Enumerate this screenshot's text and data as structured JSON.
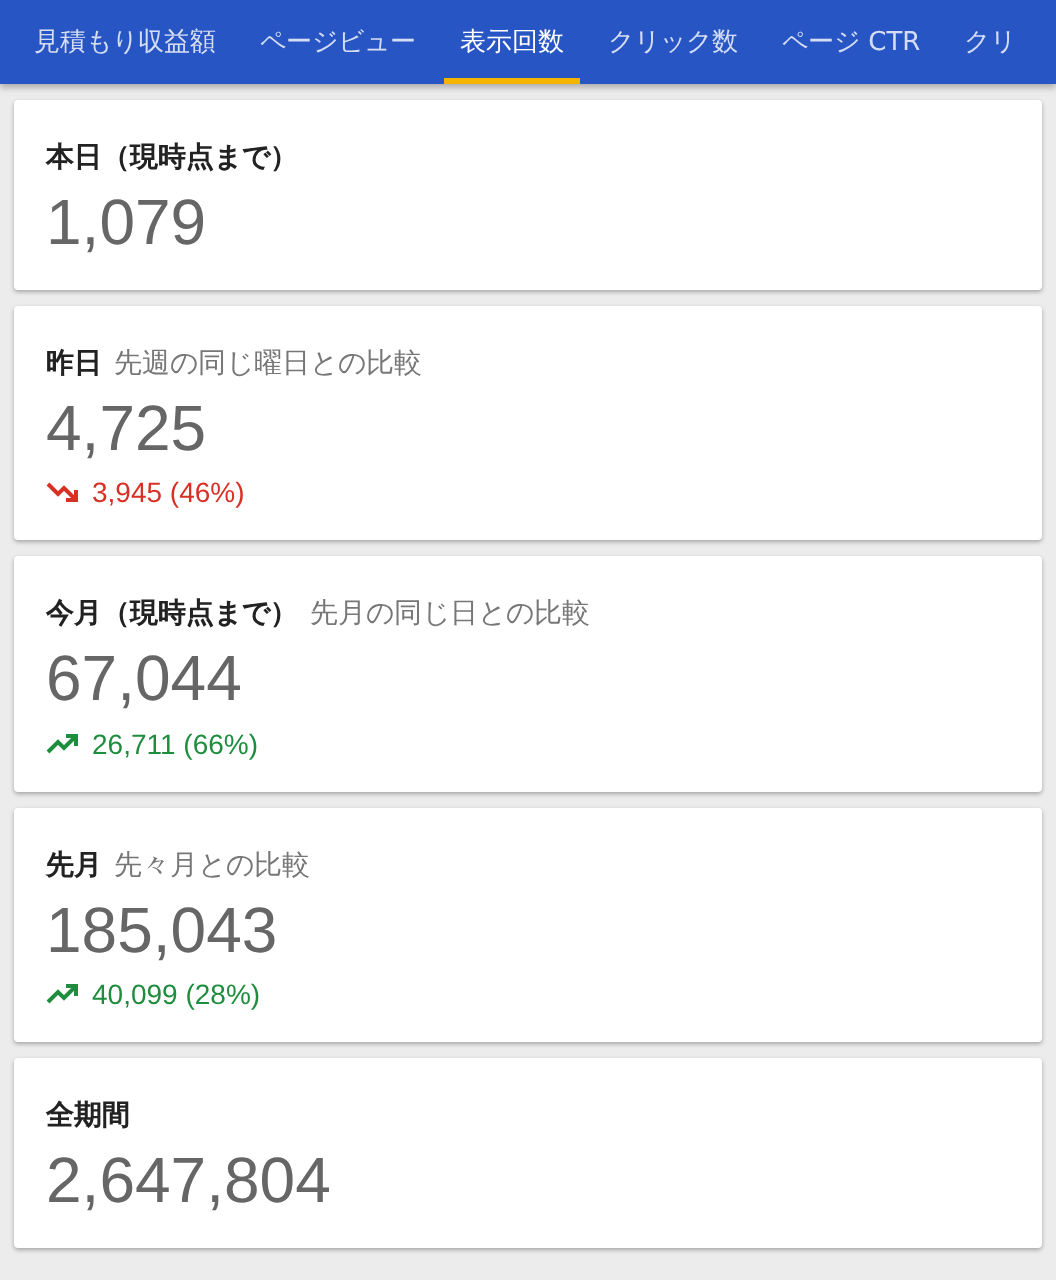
{
  "tabs": [
    {
      "label": "見積もり収益額",
      "selected": false
    },
    {
      "label": "ページビュー",
      "selected": false
    },
    {
      "label": "表示回数",
      "selected": true
    },
    {
      "label": "クリック数",
      "selected": false
    },
    {
      "label": "ページ CTR",
      "selected": false
    },
    {
      "label": "クリ",
      "selected": false
    }
  ],
  "cards": [
    {
      "title": "本日（現時点まで）",
      "value": "1,079"
    },
    {
      "title": "昨日",
      "subtitle": "先週の同じ曜日との比較",
      "value": "4,725",
      "change": {
        "kind": "down",
        "text": "3,945 (46%)"
      }
    },
    {
      "title": "今月（現時点まで）",
      "subtitle": "先月の同じ日との比較",
      "value": "67,044",
      "change": {
        "kind": "up",
        "text": "26,711 (66%)"
      }
    },
    {
      "title": "先月",
      "subtitle": "先々月との比較",
      "value": "185,043",
      "change": {
        "kind": "up",
        "text": "40,099 (28%)"
      }
    },
    {
      "title": "全期間",
      "value": "2,647,804"
    }
  ]
}
